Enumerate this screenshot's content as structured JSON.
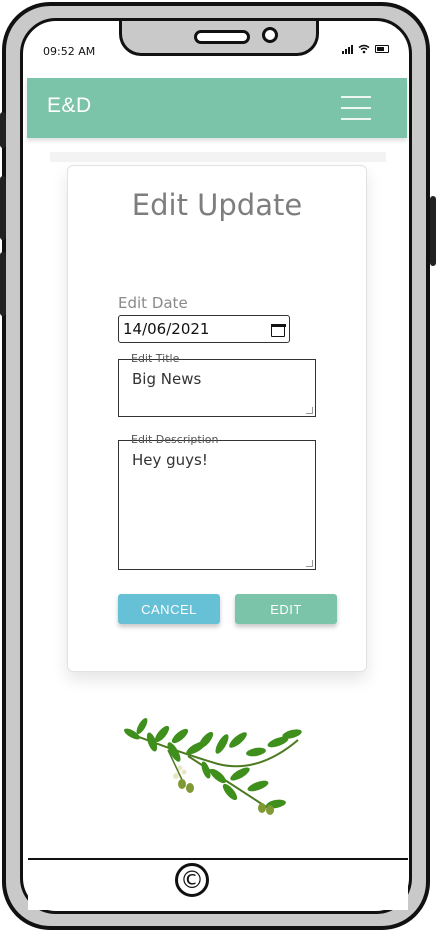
{
  "status_bar": {
    "time": "09:52 AM"
  },
  "app_bar": {
    "brand": "E&D",
    "menu_icon": "hamburger-menu-icon"
  },
  "card": {
    "title": "Edit Update",
    "date": {
      "label": "Edit Date",
      "value": "14/06/2021",
      "icon": "calendar-icon"
    },
    "title_field": {
      "legend": "Edit Title",
      "value": "Big News"
    },
    "description_field": {
      "legend": "Edit Description",
      "value": "Hey guys!"
    },
    "cancel_label": "CANCEL",
    "edit_label": "EDIT"
  },
  "footer": {
    "symbol": "©"
  },
  "colors": {
    "primary": "#7cc4a9",
    "secondary": "#67c1d6",
    "title_gray": "#7e7e7e"
  }
}
